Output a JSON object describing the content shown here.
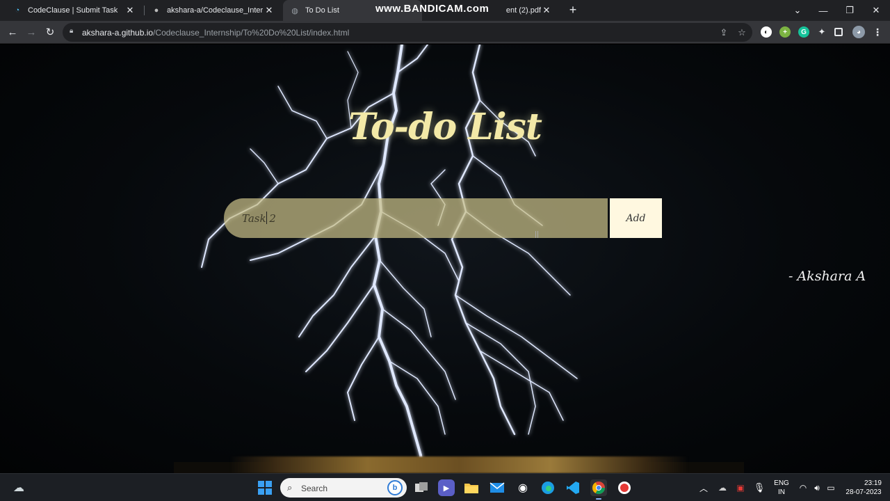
{
  "browser": {
    "tabs": [
      {
        "title": "CodeClause | Submit Task",
        "icon": "codeclause-icon",
        "active": false
      },
      {
        "title": "akshara-a/Codeclause_Internship",
        "icon": "github-icon",
        "active": false
      },
      {
        "title": "To Do List",
        "icon": "globe-icon",
        "active": true
      },
      {
        "title": "ent (2).pdf",
        "icon": "pdf-icon",
        "active": false
      }
    ],
    "watermark": "www.BANDICAM.com",
    "url_host": "akshara-a.github.io",
    "url_path": "/Codeclause_Internship/To%20Do%20List/index.html"
  },
  "page": {
    "title": "To-do List",
    "input_value": "Task 2",
    "add_label": "Add",
    "author": "- Akshara A"
  },
  "taskbar": {
    "search_placeholder": "Search",
    "lang_top": "ENG",
    "lang_bottom": "IN",
    "time": "23:19",
    "date": "28-07-2023"
  },
  "colors": {
    "title": "#f3e9a7",
    "input_bg": "#c8be87",
    "add_bg": "#fff8e0",
    "chrome_dark": "#202124",
    "chrome_mid": "#35363a"
  }
}
